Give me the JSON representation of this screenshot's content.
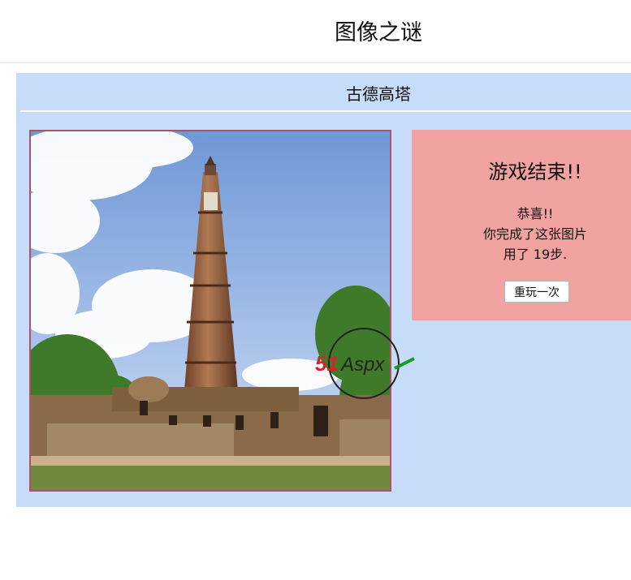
{
  "page": {
    "title": "图像之谜"
  },
  "puzzle": {
    "name": "古德高塔",
    "image_icon": "qutub-minar-photo"
  },
  "watermark": {
    "brand_red": "51",
    "brand_rest": "Aspx",
    "colors": {
      "red": "#d8232a",
      "green": "#1a9a2a",
      "dark": "#222222"
    }
  },
  "result": {
    "title": "游戏结束!!",
    "congrats": "恭喜!!",
    "message": "你完成了这张图片",
    "steps_text": "用了 19步.",
    "steps": 19,
    "replay_label": "重玩一次"
  },
  "colors": {
    "panel_bg": "#c7dcf8",
    "result_bg": "#f0a3a0",
    "frame_border": "#b0506a"
  }
}
